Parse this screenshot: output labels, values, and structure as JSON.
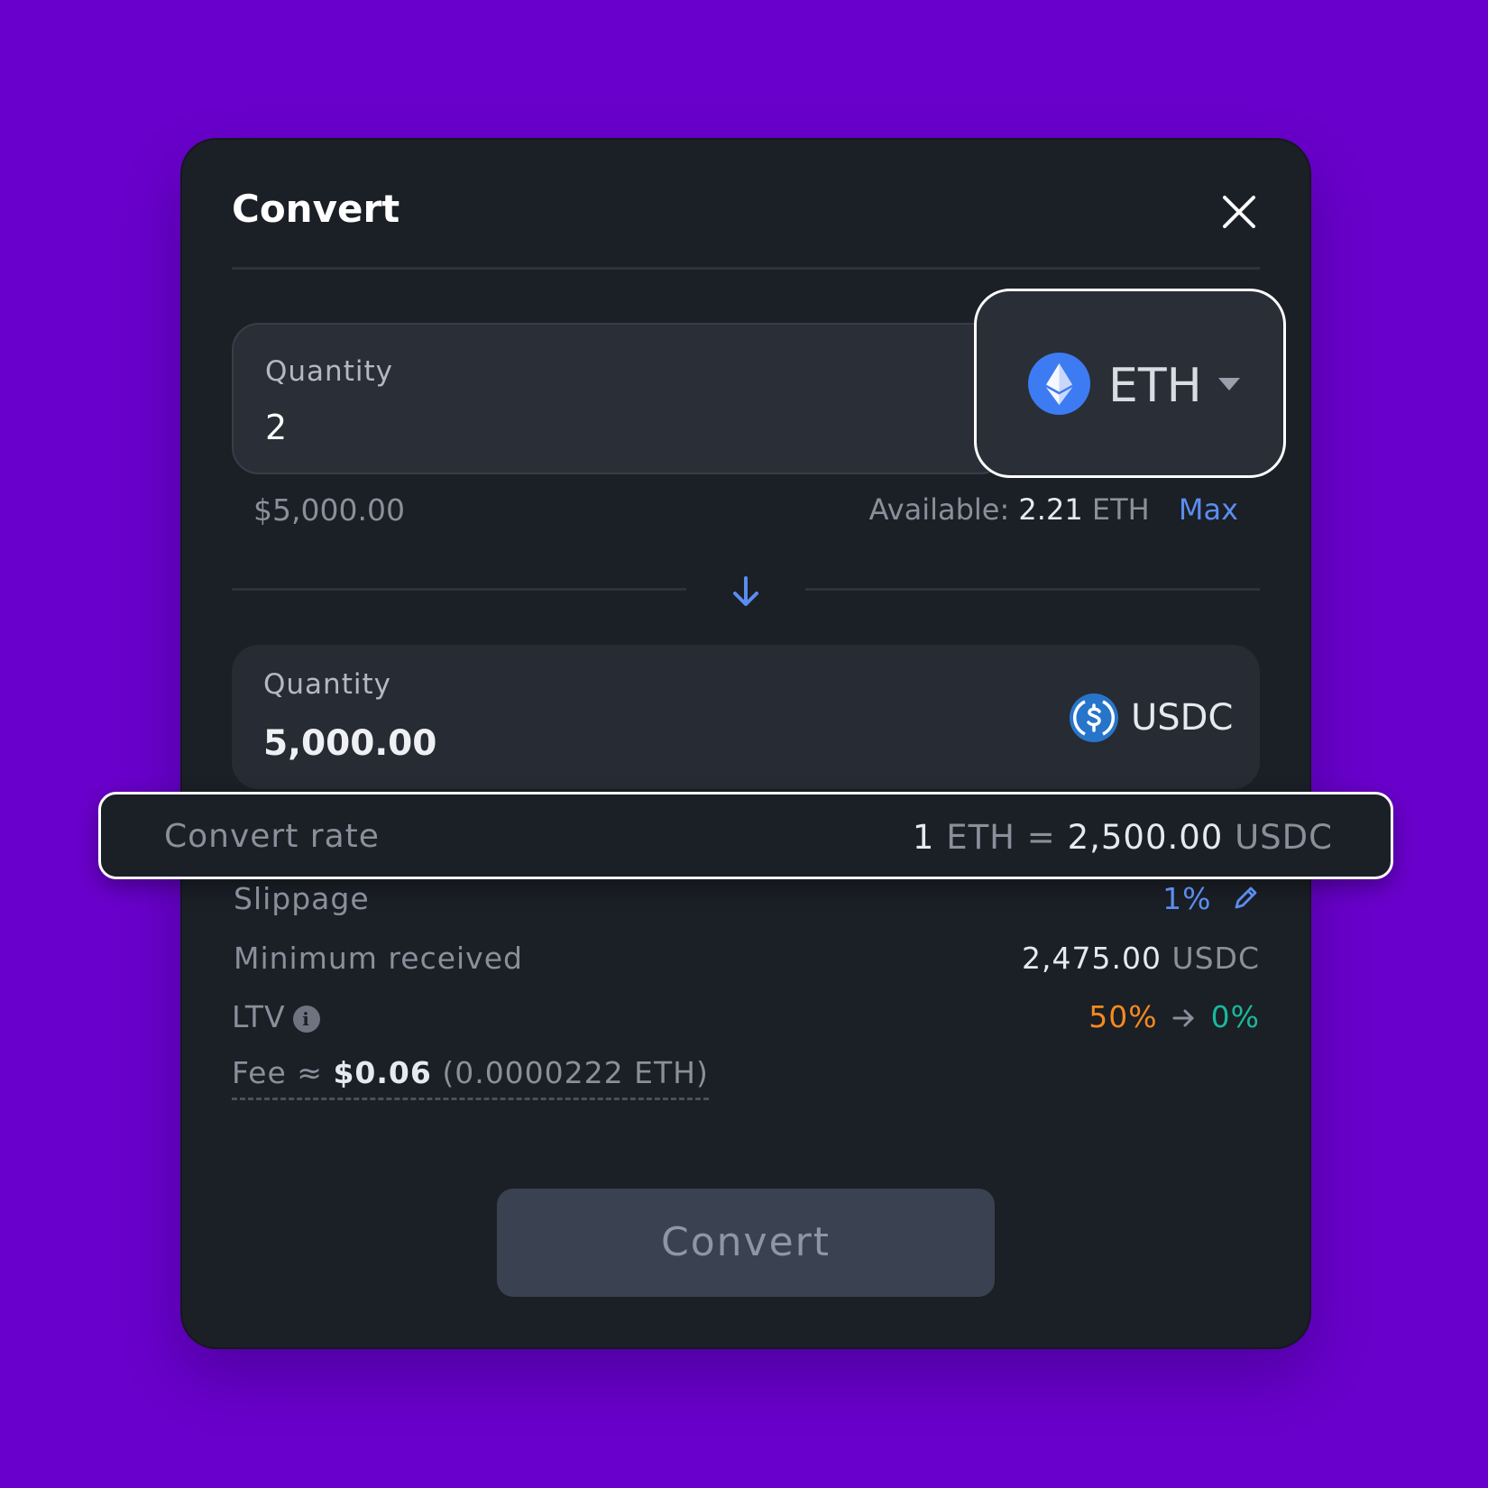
{
  "dialog": {
    "title": "Convert",
    "close_icon": "close-icon"
  },
  "from": {
    "label": "Quantity",
    "value": "2",
    "token": "ETH",
    "token_icon": "eth-icon",
    "usd_value": "$5,000.00",
    "available_label": "Available:",
    "available_amount": "2.21",
    "available_unit": "ETH",
    "max_label": "Max"
  },
  "to": {
    "label": "Quantity",
    "value": "5,000.00",
    "token": "USDC",
    "token_icon": "usdc-icon"
  },
  "details": {
    "rate_label": "Convert rate",
    "rate_base_amount": "1",
    "rate_base_unit": "ETH",
    "rate_equals": "=",
    "rate_quote_amount": "2,500.00",
    "rate_quote_unit": "USDC",
    "slippage_label": "Slippage",
    "slippage_value": "1%",
    "min_received_label": "Minimum received",
    "min_received_amount": "2,475.00",
    "min_received_unit": "USDC",
    "ltv_label": "LTV",
    "ltv_from": "50%",
    "ltv_to": "0%",
    "fee_label": "Fee ≈",
    "fee_usd": "$0.06",
    "fee_native": "(0.0000222 ETH)"
  },
  "actions": {
    "convert_label": "Convert"
  },
  "colors": {
    "background": "#6a00cc",
    "panel": "#1b1f26",
    "accent_blue": "#5b8def",
    "ltv_from": "#f7891f",
    "ltv_to": "#1ab99b"
  }
}
